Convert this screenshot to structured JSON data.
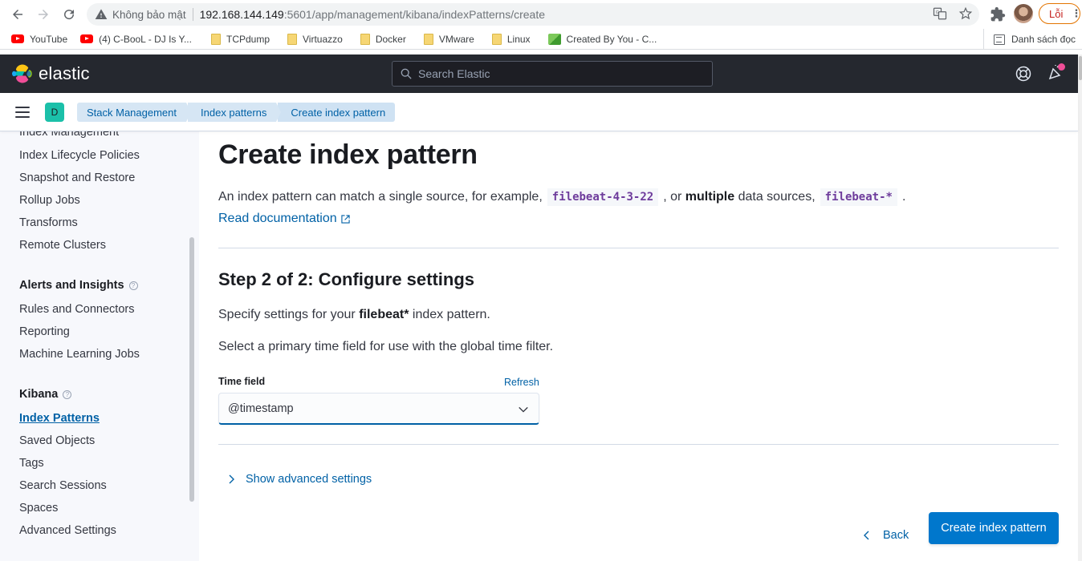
{
  "browser": {
    "security_label": "Không bảo mật",
    "url_host": "192.168.144.149",
    "url_rest": ":5601/app/management/kibana/indexPatterns/create",
    "error_label": "Lỗi",
    "bookmarks": [
      {
        "label": "YouTube",
        "icon": "youtube-icon"
      },
      {
        "label": "(4) C-BooL - DJ Is Y...",
        "icon": "youtube-icon"
      },
      {
        "label": "TCPdump",
        "icon": "folder-icon"
      },
      {
        "label": "Virtuazzo",
        "icon": "folder-icon"
      },
      {
        "label": "Docker",
        "icon": "folder-icon"
      },
      {
        "label": "VMware",
        "icon": "folder-icon"
      },
      {
        "label": "Linux",
        "icon": "folder-icon"
      },
      {
        "label": "Created By You - C...",
        "icon": "createdbyyou-icon"
      }
    ],
    "reading_list_label": "Danh sách đọc"
  },
  "header": {
    "brand": "elastic",
    "search_placeholder": "Search Elastic"
  },
  "subheader": {
    "space_initial": "D",
    "breadcrumbs": [
      "Stack Management",
      "Index patterns",
      "Create index pattern"
    ]
  },
  "sidebar": {
    "partial_top_item": "Index Management",
    "data_items": [
      "Index Lifecycle Policies",
      "Snapshot and Restore",
      "Rollup Jobs",
      "Transforms",
      "Remote Clusters"
    ],
    "alerts_title": "Alerts and Insights",
    "alerts_items": [
      "Rules and Connectors",
      "Reporting",
      "Machine Learning Jobs"
    ],
    "kibana_title": "Kibana",
    "kibana_items": [
      "Index Patterns",
      "Saved Objects",
      "Tags",
      "Search Sessions",
      "Spaces",
      "Advanced Settings"
    ],
    "active_item": "Index Patterns"
  },
  "main": {
    "title": "Create index pattern",
    "intro_before": "An index pattern can match a single source, for example,",
    "example_single": "filebeat-4-3-22",
    "intro_middle_pre": ", or",
    "intro_middle_bold": "multiple",
    "intro_middle_post": "data sources,",
    "example_multiple": "filebeat-*",
    "intro_end": ".",
    "doc_link": "Read documentation",
    "step_title": "Step 2 of 2: Configure settings",
    "para1_before": "Specify settings for your",
    "para1_pattern": "filebeat*",
    "para1_after": "index pattern.",
    "para2": "Select a primary time field for use with the global time filter.",
    "time_field_label": "Time field",
    "refresh_label": "Refresh",
    "time_field_value": "@timestamp",
    "advanced_toggle": "Show advanced settings",
    "back_button": "Back",
    "create_button": "Create index pattern"
  }
}
